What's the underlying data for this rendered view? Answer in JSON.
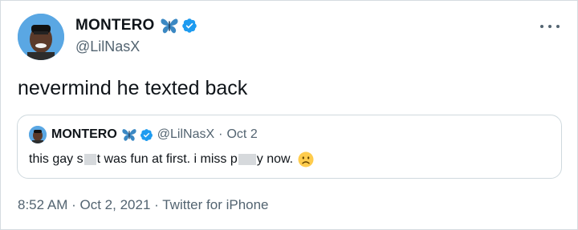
{
  "tweet": {
    "display_name": "MONTERO",
    "handle": "@LilNasX",
    "text": "nevermind he texted back",
    "timestamp": "8:52 AM",
    "date": "Oct 2, 2021",
    "separator": "·",
    "source": "Twitter for iPhone"
  },
  "quote": {
    "display_name": "MONTERO",
    "handle": "@LilNasX",
    "separator": "·",
    "date": "Oct 2",
    "text_part1": "this gay s",
    "text_part2": "t was fun at first. i miss p",
    "text_part3": "y now."
  },
  "icons": {
    "butterfly": "butterfly-emoji",
    "verified": "verified-badge",
    "more": "more-options",
    "emoji": "slightly-frowning-face"
  },
  "colors": {
    "verified_blue": "#1d9bf0",
    "butterfly_blue": "#3b88c3",
    "secondary_text": "#536471",
    "border": "#cfd9de"
  }
}
